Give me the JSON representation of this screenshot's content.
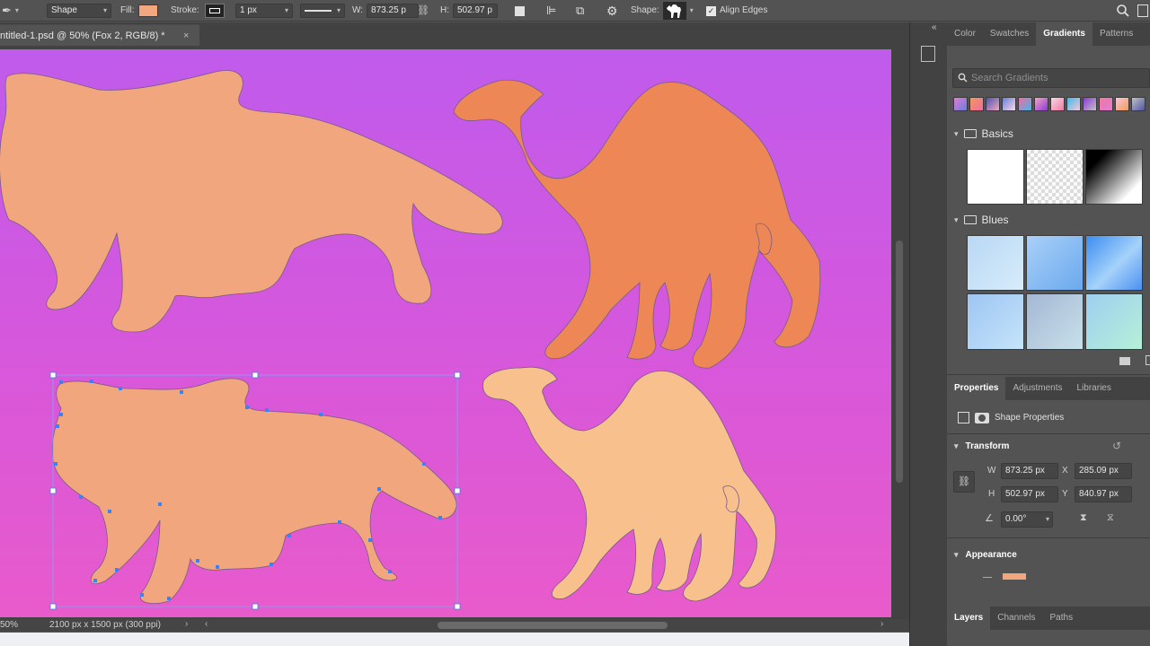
{
  "options_bar": {
    "tool_mode": "Shape",
    "fill_label": "Fill:",
    "fill_color": "#f2a77e",
    "stroke_label": "Stroke:",
    "stroke_width": "1 px",
    "w_label": "W:",
    "w_value": "873.25 p",
    "h_label": "H:",
    "h_value": "502.97 p",
    "shape_label": "Shape:",
    "align_edges_label": "Align Edges",
    "align_edges_checked": true
  },
  "document": {
    "tab_title": "ntitled-1.psd @ 50% (Fox 2, RGB/8) *",
    "close_label": "×",
    "zoom": "50%",
    "doc_info": "2100 px x 1500 px (300 ppi)"
  },
  "shapes": [
    {
      "name": "fox-1",
      "color": "#f2a67e"
    },
    {
      "name": "camel-1",
      "color": "#ee8756"
    },
    {
      "name": "fox-2",
      "color": "#f2a67e"
    },
    {
      "name": "camel-2",
      "color": "#f7c08c"
    }
  ],
  "gradients_panel": {
    "tabs": [
      "Color",
      "Swatches",
      "Gradients",
      "Patterns"
    ],
    "active_tab": "Gradients",
    "search_placeholder": "Search Gradients",
    "recent_swatches": [
      "#e07bd8",
      "#f39a5a",
      "#4e55a8",
      "#6a7fd8",
      "#f26aa4",
      "#f4a6c2",
      "#f7d8e8",
      "#3fb8e8",
      "#8a3ad8",
      "#f07aa0",
      "#f8c7d8",
      "#c2c2c2"
    ],
    "groups": [
      {
        "name": "Basics"
      },
      {
        "name": "Blues"
      }
    ]
  },
  "properties_panel": {
    "tabs": [
      "Properties",
      "Adjustments",
      "Libraries"
    ],
    "active_tab": "Properties",
    "shape_properties_label": "Shape Properties",
    "transform_label": "Transform",
    "w_label": "W",
    "w_value": "873.25 px",
    "x_label": "X",
    "x_value": "285.09 px",
    "h_label": "H",
    "h_value": "502.97 px",
    "y_label": "Y",
    "y_value": "840.97 px",
    "angle_value": "0.00°",
    "appearance_label": "Appearance",
    "appearance_color": "#f2a67e"
  },
  "layers_tabs": [
    "Layers",
    "Channels",
    "Paths"
  ],
  "layers_active_tab": "Layers"
}
